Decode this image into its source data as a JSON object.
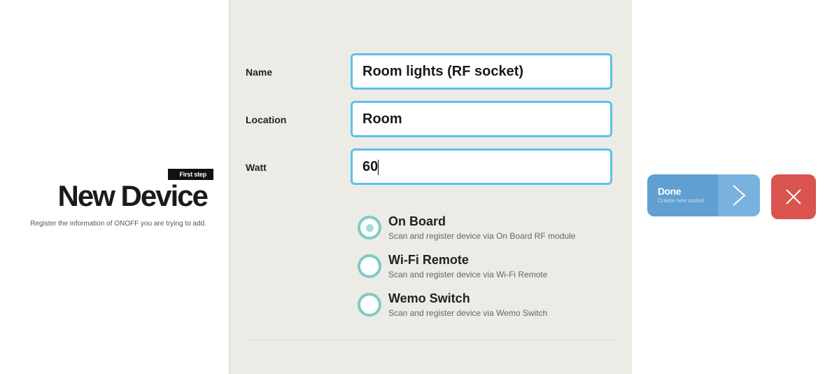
{
  "intro": {
    "step_badge": "First step",
    "title": "New Device",
    "subtitle": "Register the information of ONOFF you are trying to add."
  },
  "form": {
    "name": {
      "label": "Name",
      "value": "Room lights (RF socket)"
    },
    "location": {
      "label": "Location",
      "value": "Room"
    },
    "watt": {
      "label": "Watt",
      "value": "60"
    },
    "device_types": [
      {
        "title": "On Board",
        "description": "Scan and register device via On Board RF module",
        "selected": true
      },
      {
        "title": "Wi-Fi Remote",
        "description": "Scan and register device via Wi-Fi Remote",
        "selected": false
      },
      {
        "title": "Wemo Switch",
        "description": "Scan and register device via Wemo Switch",
        "selected": false
      }
    ]
  },
  "actions": {
    "done_label": "Done",
    "done_sublabel": "Create new socket",
    "done_icon": "chevron-right-icon",
    "close_icon": "close-icon"
  },
  "colors": {
    "input_border": "#5ec1ea",
    "radio_border": "#7dcbc5",
    "done_bg": "#5f9fd1",
    "close_bg": "#d9534f",
    "panel_bg": "#ecebe6"
  }
}
